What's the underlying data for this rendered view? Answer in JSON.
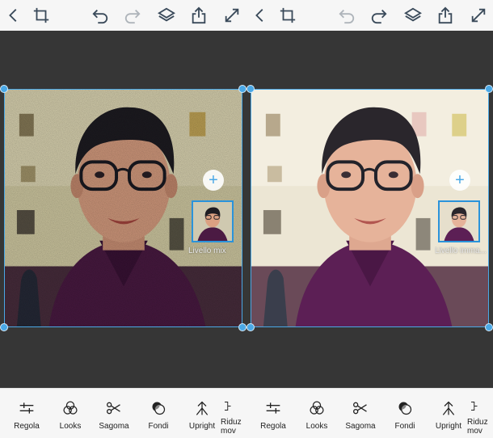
{
  "colors": {
    "accent": "#4aa8e6",
    "background": "#363636",
    "toolbar": "#f6f6f6",
    "icon": "#3a4a5a"
  },
  "panes": [
    {
      "layer_label": "Livello mix",
      "add_layer_symbol": "+",
      "tools": [
        {
          "label": "Regola",
          "icon": "sliders-icon"
        },
        {
          "label": "Looks",
          "icon": "looks-icon"
        },
        {
          "label": "Sagoma",
          "icon": "scissors-icon"
        },
        {
          "label": "Fondi",
          "icon": "blend-icon"
        },
        {
          "label": "Upright",
          "icon": "upright-icon"
        },
        {
          "label": "Riduz\nmov",
          "icon": "shake-reduction-icon"
        }
      ]
    },
    {
      "layer_label": "Livello imma...",
      "add_layer_symbol": "+",
      "tools": [
        {
          "label": "Regola",
          "icon": "sliders-icon"
        },
        {
          "label": "Looks",
          "icon": "looks-icon"
        },
        {
          "label": "Sagoma",
          "icon": "scissors-icon"
        },
        {
          "label": "Fondi",
          "icon": "blend-icon"
        },
        {
          "label": "Upright",
          "icon": "upright-icon"
        },
        {
          "label": "Riduz\nmov",
          "icon": "shake-reduction-icon"
        }
      ]
    }
  ],
  "topbar_icons": [
    "back-icon",
    "crop-icon",
    "undo-icon",
    "redo-icon",
    "layers-icon",
    "share-icon",
    "fullscreen-icon"
  ]
}
